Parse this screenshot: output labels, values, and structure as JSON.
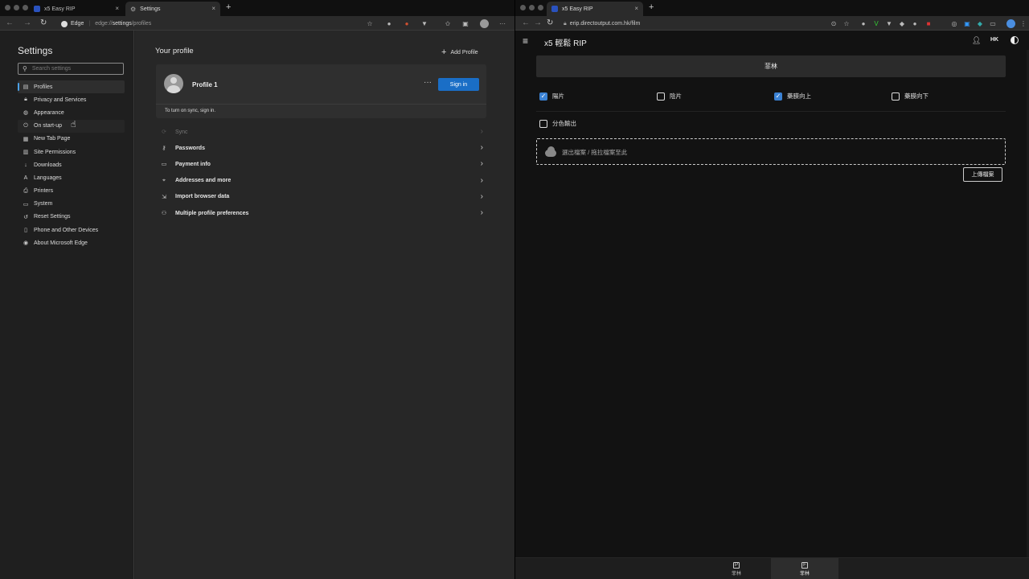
{
  "left_window": {
    "tabs": [
      {
        "label": "x5 Easy RIP",
        "close": "×"
      },
      {
        "label": "Settings",
        "close": "×"
      }
    ],
    "new_tab": "+",
    "address": {
      "brand": "Edge",
      "url_prefix": "edge://",
      "url_bold": "settings",
      "url_suffix": "/profiles"
    },
    "settings_title": "Settings",
    "search_placeholder": "Search settings",
    "sidebar": [
      {
        "label": "Profiles",
        "icon": "profile-icon"
      },
      {
        "label": "Privacy and Services",
        "icon": "lock-icon"
      },
      {
        "label": "Appearance",
        "icon": "palette-icon"
      },
      {
        "label": "On start-up",
        "icon": "power-icon"
      },
      {
        "label": "New Tab Page",
        "icon": "new-tab-icon"
      },
      {
        "label": "Site Permissions",
        "icon": "site-permissions-icon"
      },
      {
        "label": "Downloads",
        "icon": "download-icon"
      },
      {
        "label": "Languages",
        "icon": "language-icon"
      },
      {
        "label": "Printers",
        "icon": "printer-icon"
      },
      {
        "label": "System",
        "icon": "system-icon"
      },
      {
        "label": "Reset Settings",
        "icon": "reset-icon"
      },
      {
        "label": "Phone and Other Devices",
        "icon": "phone-icon"
      },
      {
        "label": "About Microsoft Edge",
        "icon": "edge-icon"
      }
    ],
    "main": {
      "heading": "Your profile",
      "add_profile": "Add Profile",
      "profile_name": "Profile 1",
      "more": "···",
      "sign_in": "Sign in",
      "sync_hint": "To turn on sync, sign in.",
      "rows": [
        {
          "label": "Sync",
          "icon": "sync-icon"
        },
        {
          "label": "Passwords",
          "icon": "key-icon"
        },
        {
          "label": "Payment info",
          "icon": "card-icon"
        },
        {
          "label": "Addresses and more",
          "icon": "location-icon"
        },
        {
          "label": "Import browser data",
          "icon": "import-icon"
        },
        {
          "label": "Multiple profile preferences",
          "icon": "multi-profile-icon"
        }
      ]
    }
  },
  "right_window": {
    "tab": {
      "label": "x5 Easy RIP",
      "close": "×"
    },
    "new_tab": "+",
    "url": "erip.directoutput.com.hk/film",
    "app_title": "x5 輕鬆 RIP",
    "lang": "HK",
    "film_bar": "菲林",
    "checkboxes": [
      {
        "label": "陽片",
        "checked": true
      },
      {
        "label": "陰片",
        "checked": false
      },
      {
        "label": "藥膜向上",
        "checked": true
      },
      {
        "label": "藥膜向下",
        "checked": false
      },
      {
        "label": "分色輸出",
        "checked": false
      }
    ],
    "dropzone": "選出檔案 / 拖拉檔案至此",
    "upload": "上傳檔案",
    "bottom_nav": [
      {
        "label": "菲林",
        "icon_letter": "P",
        "active": false
      },
      {
        "label": "菲林",
        "icon_letter": "F",
        "active": true
      }
    ]
  },
  "colors": {
    "accent": "#1a6ec6",
    "checkbox": "#3b82d4",
    "selected_indicator": "#4aa0e6"
  }
}
